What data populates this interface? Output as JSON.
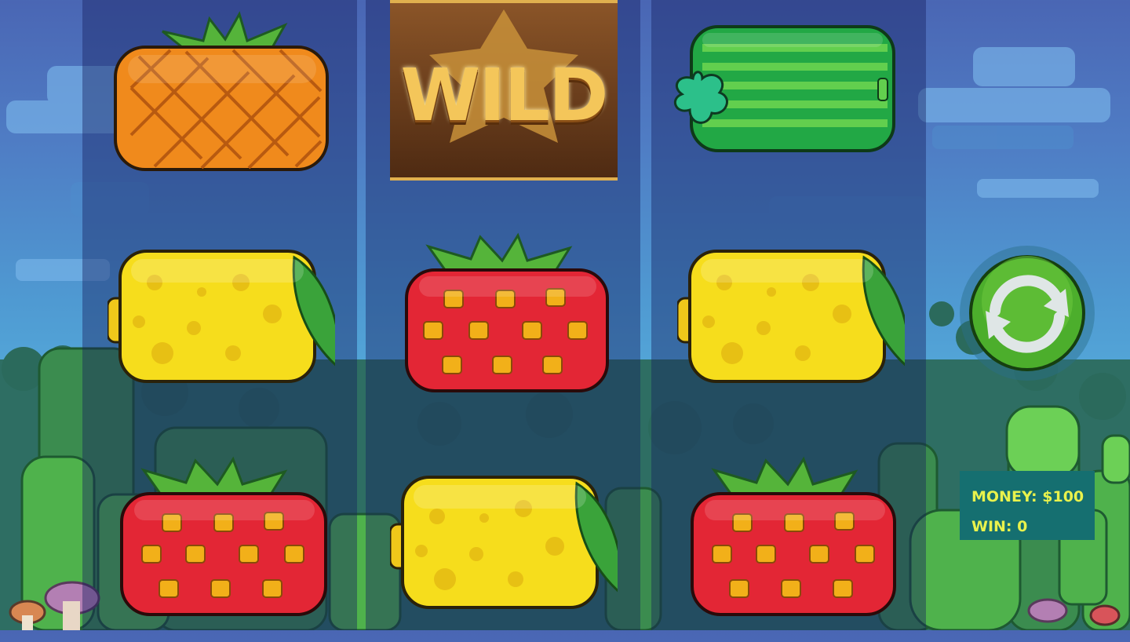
{
  "colors": {
    "sky_top": "#4a66b4",
    "reel_shade": "rgba(22,32,95,0.42)",
    "panel_bg": "#156f70",
    "panel_text": "#e9f24c",
    "spin_green": "#4cae2c"
  },
  "reels": [
    {
      "symbols": [
        "pineapple",
        "lemon",
        "strawberry"
      ]
    },
    {
      "symbols": [
        "wild",
        "strawberry",
        "lemon"
      ]
    },
    {
      "symbols": [
        "watermelon",
        "lemon",
        "strawberry"
      ]
    }
  ],
  "wild_symbol": {
    "label": "WILD"
  },
  "spin_button": {
    "icon": "refresh-arrows-icon"
  },
  "status": {
    "money_label": "MONEY: $100",
    "win_label": "WIN: 0"
  }
}
